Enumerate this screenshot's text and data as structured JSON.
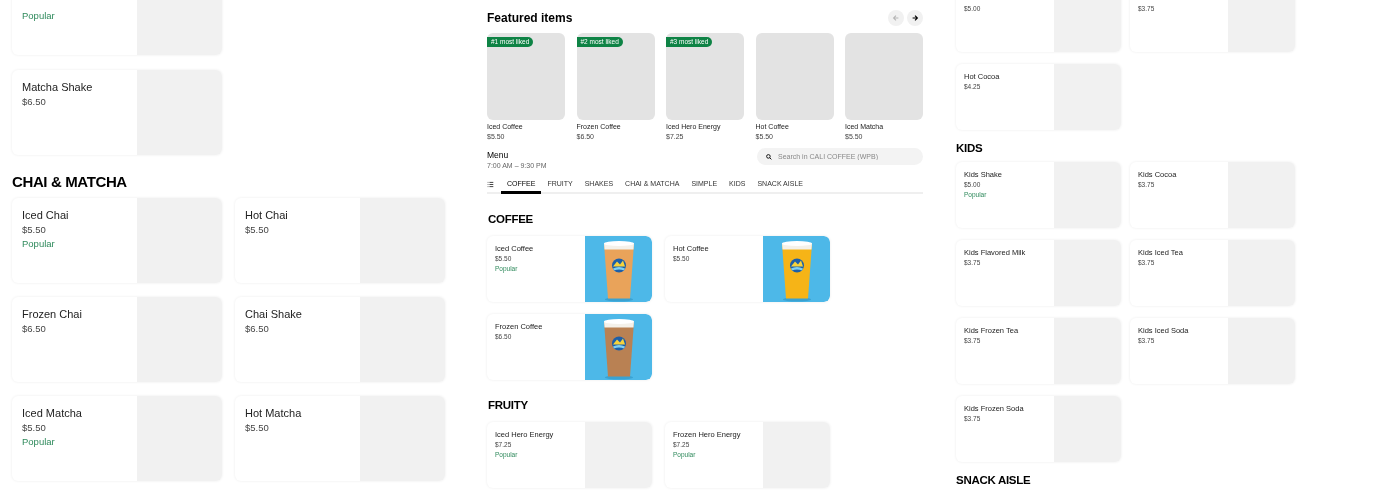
{
  "left_panel": {
    "sections": [
      {
        "items": [
          {
            "badge": "Popular"
          }
        ]
      },
      {
        "items": [
          {
            "name": "Matcha Shake",
            "price": "$6.50"
          }
        ]
      },
      {
        "heading": "CHAI & MATCHA",
        "items": [
          {
            "name": "Iced Chai",
            "price": "$5.50",
            "badge": "Popular"
          },
          {
            "name": "Hot Chai",
            "price": "$5.50"
          },
          {
            "name": "Frozen Chai",
            "price": "$6.50"
          },
          {
            "name": "Chai Shake",
            "price": "$6.50"
          },
          {
            "name": "Iced Matcha",
            "price": "$5.50",
            "badge": "Popular"
          },
          {
            "name": "Hot Matcha",
            "price": "$5.50"
          }
        ]
      }
    ]
  },
  "center_panel": {
    "featured": {
      "title": "Featured items",
      "carousel_buttons": [
        {
          "kind": "prev",
          "disabled": true
        },
        {
          "kind": "next",
          "disabled": false
        }
      ],
      "items": [
        {
          "rank": "#1 most liked",
          "name": "Iced Coffee",
          "price": "$5.50"
        },
        {
          "rank": "#2 most liked",
          "name": "Frozen Coffee",
          "price": "$6.50"
        },
        {
          "rank": "#3 most liked",
          "name": "Iced Hero Energy",
          "price": "$7.25"
        },
        {
          "name": "Hot Coffee",
          "price": "$5.50"
        },
        {
          "name": "Iced Matcha",
          "price": "$5.50"
        }
      ]
    },
    "menu": {
      "title": "Menu",
      "hours": "7:00 AM – 9:30 PM"
    },
    "search": {
      "placeholder": "Search in CALI COFFEE (WPB)"
    },
    "tabs": [
      {
        "label": "COFFEE",
        "selected": true
      },
      {
        "label": "FRUITY",
        "selected": false
      },
      {
        "label": "SHAKES",
        "selected": false
      },
      {
        "label": "CHAI & MATCHA",
        "selected": false
      },
      {
        "label": "SIMPLE",
        "selected": false
      },
      {
        "label": "KIDS",
        "selected": false
      },
      {
        "label": "SNACK AISLE",
        "selected": false
      }
    ],
    "sections": [
      {
        "heading": "COFFEE",
        "items": [
          {
            "name": "Iced Coffee",
            "price": "$5.50",
            "badge": "Popular",
            "kind": "picture"
          },
          {
            "name": "Hot Coffee",
            "price": "$5.50",
            "kind": "picture"
          },
          {
            "name": "Frozen Coffee",
            "price": "$6.50",
            "kind": "picture"
          }
        ]
      },
      {
        "heading": "FRUITY",
        "items": [
          {
            "name": "Iced Hero Energy",
            "price": "$7.25",
            "badge": "Popular"
          },
          {
            "name": "Frozen Hero Energy",
            "price": "$7.25",
            "badge": "Popular"
          }
        ]
      }
    ]
  },
  "right_panel": {
    "sections": [
      {
        "items": [
          {
            "price": "$5.00"
          },
          {
            "price": "$3.75"
          },
          {
            "name": "Hot Cocoa",
            "price": "$4.25"
          }
        ]
      },
      {
        "heading": "KIDS",
        "items": [
          {
            "name": "Kids Shake",
            "price": "$5.00",
            "badge": "Popular"
          },
          {
            "name": "Kids Cocoa",
            "price": "$3.75"
          },
          {
            "name": "Kids Flavored Milk",
            "price": "$3.75"
          },
          {
            "name": "Kids Iced Tea",
            "price": "$3.75"
          },
          {
            "name": "Kids Frozen Tea",
            "price": "$3.75"
          },
          {
            "name": "Kids Iced Soda",
            "price": "$3.75"
          },
          {
            "name": "Kids Frozen Soda",
            "price": "$3.75"
          }
        ]
      },
      {
        "heading": "SNACK AISLE"
      }
    ]
  }
}
